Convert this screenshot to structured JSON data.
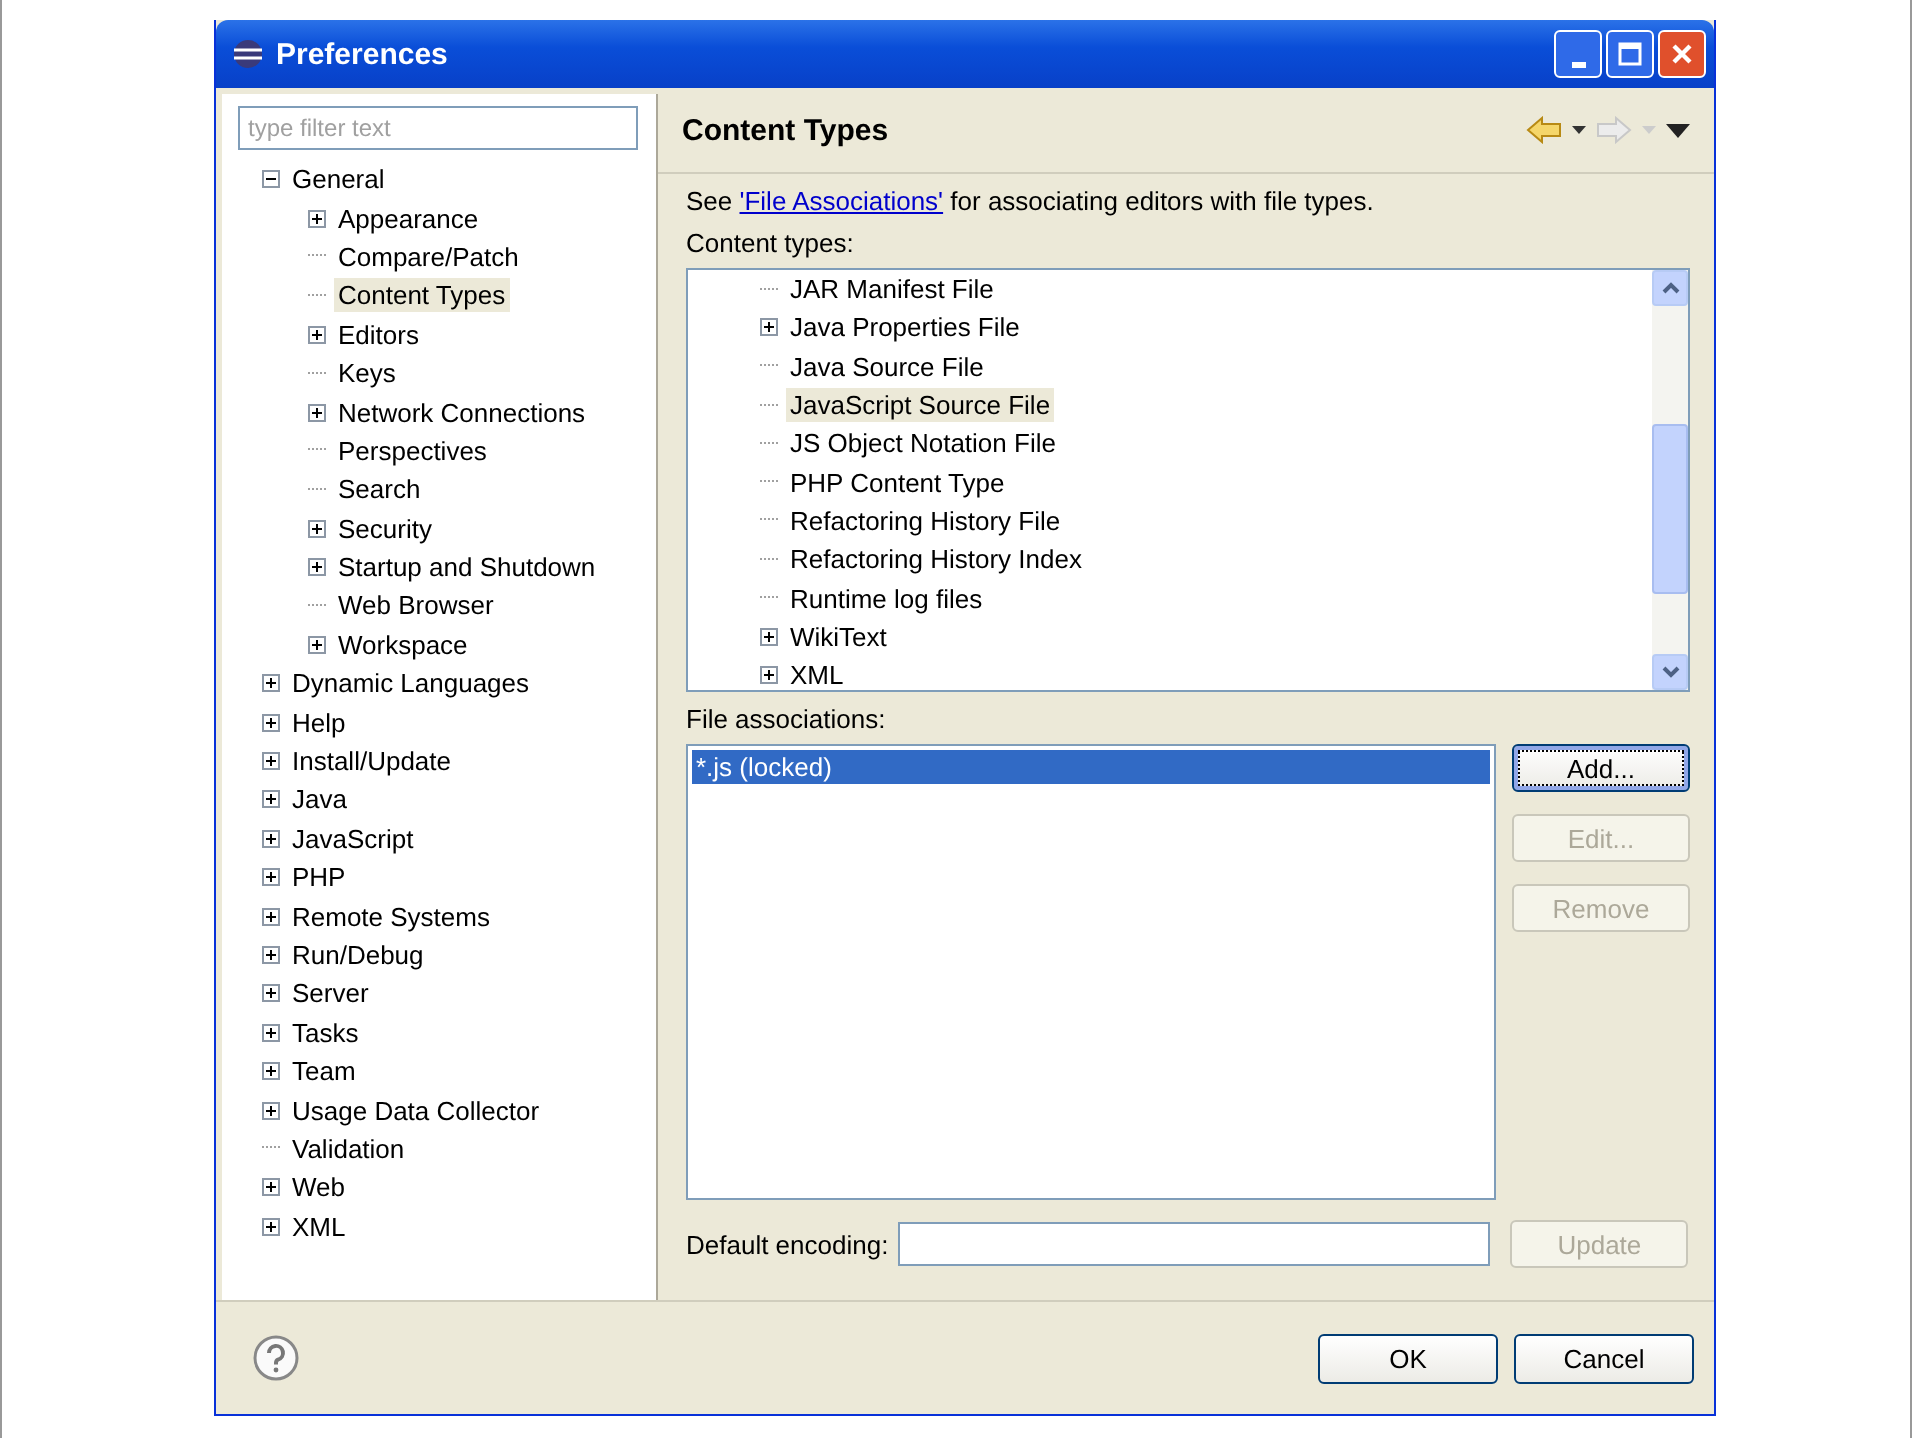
{
  "window": {
    "title": "Preferences"
  },
  "filter": {
    "placeholder": "type filter text"
  },
  "tree": [
    {
      "label": "General",
      "kind": "folder",
      "expanded": true,
      "selected": false,
      "children": [
        {
          "label": "Appearance",
          "kind": "folder",
          "expanded": false,
          "selected": false
        },
        {
          "label": "Compare/Patch",
          "kind": "leaf",
          "selected": false
        },
        {
          "label": "Content Types",
          "kind": "leaf",
          "selected": true
        },
        {
          "label": "Editors",
          "kind": "folder",
          "expanded": false,
          "selected": false
        },
        {
          "label": "Keys",
          "kind": "leaf",
          "selected": false
        },
        {
          "label": "Network Connections",
          "kind": "folder",
          "expanded": false,
          "selected": false
        },
        {
          "label": "Perspectives",
          "kind": "leaf",
          "selected": false
        },
        {
          "label": "Search",
          "kind": "leaf",
          "selected": false
        },
        {
          "label": "Security",
          "kind": "folder",
          "expanded": false,
          "selected": false
        },
        {
          "label": "Startup and Shutdown",
          "kind": "folder",
          "expanded": false,
          "selected": false
        },
        {
          "label": "Web Browser",
          "kind": "leaf",
          "selected": false
        },
        {
          "label": "Workspace",
          "kind": "folder",
          "expanded": false,
          "selected": false
        }
      ]
    },
    {
      "label": "Dynamic Languages",
      "kind": "folder",
      "expanded": false,
      "selected": false
    },
    {
      "label": "Help",
      "kind": "folder",
      "expanded": false,
      "selected": false
    },
    {
      "label": "Install/Update",
      "kind": "folder",
      "expanded": false,
      "selected": false
    },
    {
      "label": "Java",
      "kind": "folder",
      "expanded": false,
      "selected": false
    },
    {
      "label": "JavaScript",
      "kind": "folder",
      "expanded": false,
      "selected": false
    },
    {
      "label": "PHP",
      "kind": "folder",
      "expanded": false,
      "selected": false
    },
    {
      "label": "Remote Systems",
      "kind": "folder",
      "expanded": false,
      "selected": false
    },
    {
      "label": "Run/Debug",
      "kind": "folder",
      "expanded": false,
      "selected": false
    },
    {
      "label": "Server",
      "kind": "folder",
      "expanded": false,
      "selected": false
    },
    {
      "label": "Tasks",
      "kind": "folder",
      "expanded": false,
      "selected": false
    },
    {
      "label": "Team",
      "kind": "folder",
      "expanded": false,
      "selected": false
    },
    {
      "label": "Usage Data Collector",
      "kind": "folder",
      "expanded": false,
      "selected": false
    },
    {
      "label": "Validation",
      "kind": "leaf",
      "selected": false
    },
    {
      "label": "Web",
      "kind": "folder",
      "expanded": false,
      "selected": false
    },
    {
      "label": "XML",
      "kind": "folder",
      "expanded": false,
      "selected": false
    }
  ],
  "page": {
    "title": "Content Types",
    "back_enabled": true,
    "forward_enabled": false
  },
  "intro": {
    "before": "See ",
    "link": "'File Associations'",
    "after": " for associating editors with file types."
  },
  "content_types_label": "Content types:",
  "content_types": [
    {
      "label": "JAR Manifest File",
      "kind": "leaf",
      "selected": false
    },
    {
      "label": "Java Properties File",
      "kind": "folder",
      "expanded": false,
      "selected": false
    },
    {
      "label": "Java Source File",
      "kind": "leaf",
      "selected": false
    },
    {
      "label": "JavaScript Source File",
      "kind": "leaf",
      "selected": true
    },
    {
      "label": "JS Object Notation File",
      "kind": "leaf",
      "selected": false
    },
    {
      "label": "PHP Content Type",
      "kind": "leaf",
      "selected": false
    },
    {
      "label": "Refactoring History File",
      "kind": "leaf",
      "selected": false
    },
    {
      "label": "Refactoring History Index",
      "kind": "leaf",
      "selected": false
    },
    {
      "label": "Runtime log files",
      "kind": "leaf",
      "selected": false
    },
    {
      "label": "WikiText",
      "kind": "folder",
      "expanded": false,
      "selected": false
    },
    {
      "label": "XML",
      "kind": "folder",
      "expanded": false,
      "selected": false
    }
  ],
  "file_associations_label": "File associations:",
  "file_associations": [
    {
      "label": "*.js (locked)",
      "selected": true
    }
  ],
  "association_buttons": [
    {
      "label": "Add...",
      "disabled": false,
      "focused": true
    },
    {
      "label": "Edit...",
      "disabled": true,
      "focused": false
    },
    {
      "label": "Remove",
      "disabled": true,
      "focused": false
    }
  ],
  "encoding": {
    "label": "Default encoding:",
    "button": {
      "label": "Update",
      "disabled": true
    }
  },
  "dialog_buttons": [
    "OK",
    "Cancel"
  ]
}
